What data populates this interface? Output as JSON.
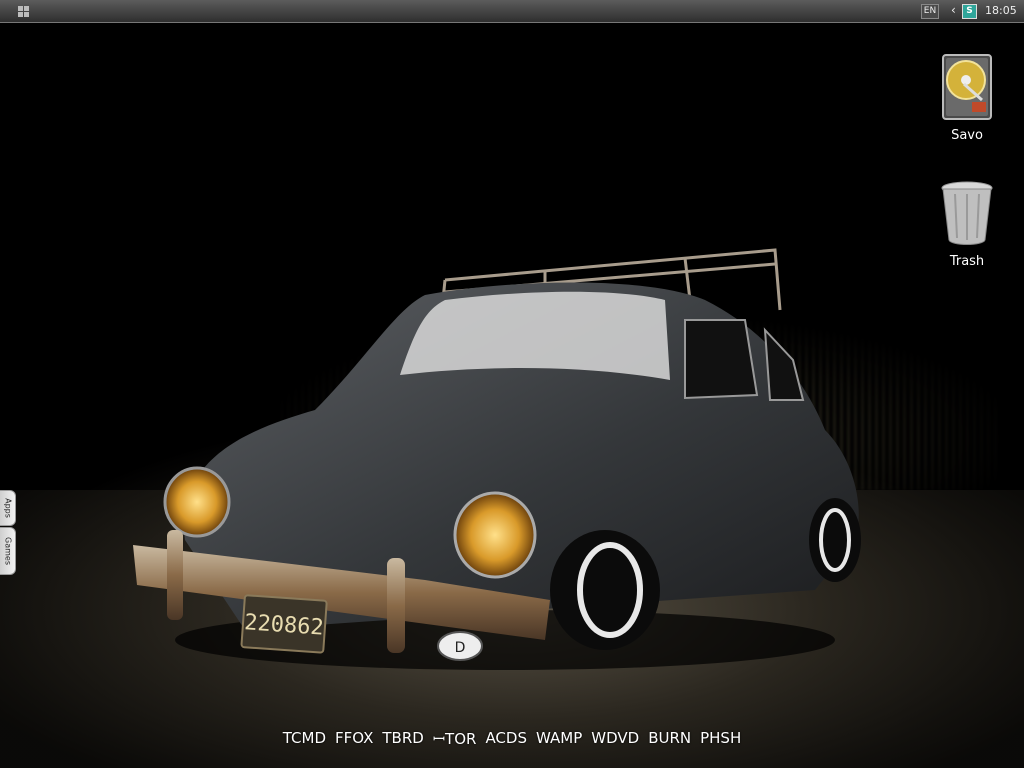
{
  "topbar": {
    "lang": "EN",
    "clock": "18:05",
    "tray_arrow": "‹",
    "tray_icon": "S"
  },
  "desktop": {
    "icons": [
      {
        "label": "Savo",
        "icon": "hard-drive-icon"
      },
      {
        "label": "Trash",
        "icon": "trash-icon"
      }
    ],
    "side_tabs": [
      "Apps",
      "Games"
    ]
  },
  "wallpaper": {
    "plate": "220862",
    "badge": "D"
  },
  "dock": {
    "items": [
      "TCMD",
      "FFOX",
      "TBRD",
      "ꟷTOR",
      "ACDS",
      "WAMP",
      "WDVD",
      "BURN",
      "PHSH"
    ]
  },
  "colors": {
    "panel": "#3a3a3a",
    "tray_icon": "#2fa59a",
    "background": "#000000"
  }
}
